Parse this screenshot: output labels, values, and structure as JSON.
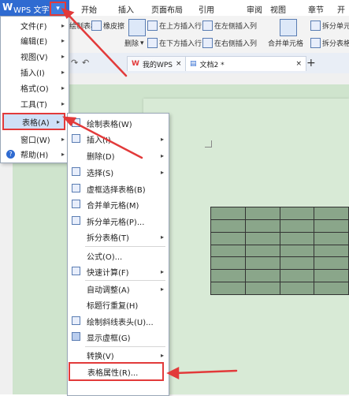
{
  "app": {
    "logo": "W",
    "title": "WPS 文字",
    "menu_arrow": "▾"
  },
  "ribbon_tabs": [
    "开始",
    "插入",
    "页面布局",
    "引用",
    "审阅",
    "视图",
    "章节",
    "开发"
  ],
  "ribbon": {
    "draw_table": "绘制表格",
    "eraser": "橡皮擦",
    "delete": "删除",
    "insert_row_above": "在上方插入行",
    "insert_row_below": "在下方插入行",
    "insert_col_left": "在左侧插入列",
    "insert_col_right": "在右侧插入列",
    "merge_cells": "合并单元格",
    "split_cells": "拆分单元格",
    "split_table": "拆分表格"
  },
  "doc_tabs": [
    {
      "label": "我的WPS",
      "close": "×"
    },
    {
      "label": "文档2 *",
      "close": "×"
    }
  ],
  "add_tab": "+",
  "file_menu": [
    {
      "label": "文件(F)",
      "arrow": "▸"
    },
    {
      "label": "编辑(E)",
      "arrow": "▸"
    },
    {
      "label": "视图(V)",
      "arrow": "▸"
    },
    {
      "label": "插入(I)",
      "arrow": "▸"
    },
    {
      "label": "格式(O)",
      "arrow": "▸"
    },
    {
      "label": "工具(T)",
      "arrow": "▸"
    },
    {
      "label": "表格(A)",
      "arrow": "▸"
    },
    {
      "label": "窗口(W)",
      "arrow": "▸"
    },
    {
      "label": "帮助(H)",
      "arrow": "▸"
    }
  ],
  "help_icon": "?",
  "table_submenu": [
    {
      "label": "绘制表格(W)"
    },
    {
      "label": "插入(I)",
      "arrow": "▸"
    },
    {
      "label": "删除(D)",
      "arrow": "▸"
    },
    {
      "label": "选择(S)",
      "arrow": "▸"
    },
    {
      "label": "虚框选择表格(B)"
    },
    {
      "label": "合并单元格(M)"
    },
    {
      "label": "拆分单元格(P)..."
    },
    {
      "label": "拆分表格(T)",
      "arrow": "▸"
    },
    {
      "label": "公式(O)..."
    },
    {
      "label": "快速计算(F)",
      "arrow": "▸"
    },
    {
      "label": "自动调整(A)",
      "arrow": "▸"
    },
    {
      "label": "标题行重复(H)"
    },
    {
      "label": "绘制斜线表头(U)..."
    },
    {
      "label": "显示虚框(G)"
    },
    {
      "label": "转换(V)",
      "arrow": "▸"
    },
    {
      "label": "表格属性(R)..."
    }
  ],
  "colors": {
    "accent": "#2f6bd1",
    "highlight_border": "#e23a3a",
    "document_bg": "#cfe4cd",
    "table_fill": "#8aa68a"
  }
}
